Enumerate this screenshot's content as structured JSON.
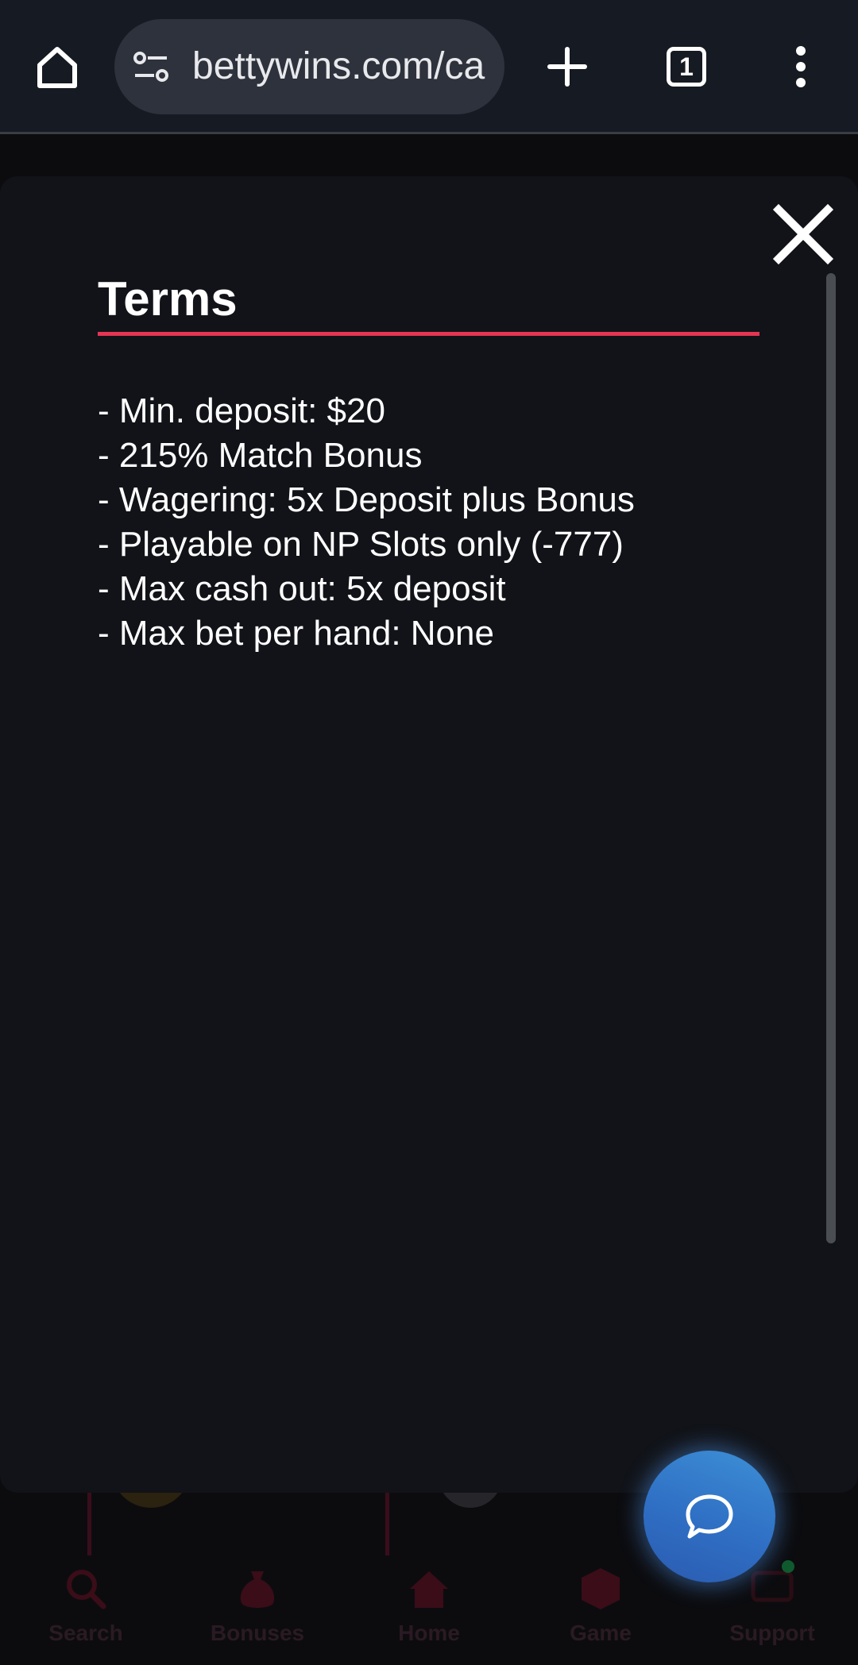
{
  "browser": {
    "url_display": "bettywins.com/ca",
    "tab_count": "1",
    "icons": {
      "home": "home-icon",
      "site_info": "tune-icon",
      "new_tab": "plus-icon",
      "tabs": "tab-switcher-icon",
      "menu": "more-vert-icon"
    }
  },
  "background_page": {
    "bottom_nav": [
      {
        "label": "Search",
        "icon": "search-icon"
      },
      {
        "label": "Bonuses",
        "icon": "money-bag-icon"
      },
      {
        "label": "Home",
        "icon": "home-icon"
      },
      {
        "label": "Game",
        "icon": "dice-icon"
      },
      {
        "label": "Support",
        "icon": "chat-support-icon"
      }
    ]
  },
  "modal": {
    "title": "Terms",
    "terms": [
      "- Min. deposit: $20",
      "- 215% Match Bonus",
      "- Wagering: 5x Deposit plus Bonus",
      "- Playable on NP Slots only (-777)",
      "- Max cash out: 5x deposit",
      "- Max bet per hand: None"
    ],
    "close_icon": "close-icon"
  },
  "chat_button": {
    "icon": "chat-bubble-icon"
  },
  "colors": {
    "accent_rule": "#e53553",
    "modal_bg": "#111318",
    "toolbar_bg": "#161a22",
    "chat_fab": "#2f6fc4"
  }
}
